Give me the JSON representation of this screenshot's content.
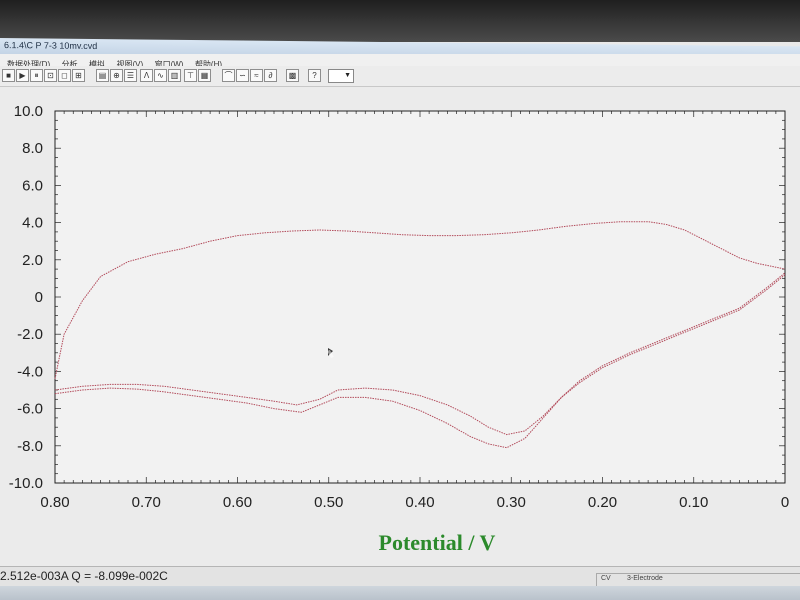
{
  "window": {
    "title": "6.1.4\\C P 7-3 10mv.cvd"
  },
  "menu": {
    "items": [
      "数据处理(D)",
      "分析",
      "模拟",
      "视图(V)",
      "窗口(W)",
      "帮助(H)"
    ]
  },
  "toolbar": {
    "combo_value": ""
  },
  "colors": {
    "curve": "#b24a5a",
    "axis": "#222222",
    "xlabel": "#2b8a2b"
  },
  "chart_data": {
    "type": "line",
    "title": "",
    "xlabel": "Potential / V",
    "ylabel": "",
    "xlim": [
      0.8,
      0.0
    ],
    "ylim": [
      -10.0,
      10.0
    ],
    "x_ticks": [
      0.8,
      0.7,
      0.6,
      0.5,
      0.4,
      0.3,
      0.2,
      0.1,
      0
    ],
    "x_tick_labels": [
      "0.80",
      "0.70",
      "0.60",
      "0.50",
      "0.40",
      "0.30",
      "0.20",
      "0.10",
      "0"
    ],
    "y_ticks": [
      10.0,
      8.0,
      6.0,
      4.0,
      2.0,
      0,
      -2.0,
      -4.0,
      -6.0,
      -8.0,
      -10.0
    ],
    "y_tick_labels": [
      "10.0",
      "8.0",
      "6.0",
      "4.0",
      "2.0",
      "0",
      "-2.0",
      "-4.0",
      "-6.0",
      "-8.0",
      "-10.0"
    ],
    "grid": false,
    "series": [
      {
        "x": [
          0.8,
          0.79,
          0.77,
          0.75,
          0.72,
          0.69,
          0.66,
          0.63,
          0.6,
          0.57,
          0.54,
          0.51,
          0.48,
          0.45,
          0.42,
          0.39,
          0.36,
          0.33,
          0.3,
          0.27,
          0.24,
          0.21,
          0.18,
          0.15,
          0.13,
          0.11,
          0.09,
          0.07,
          0.05,
          0.03,
          0.01,
          0.0
        ],
        "y": [
          -4.4,
          -2.0,
          -0.2,
          1.1,
          1.9,
          2.3,
          2.6,
          3.0,
          3.3,
          3.45,
          3.55,
          3.6,
          3.55,
          3.45,
          3.35,
          3.3,
          3.3,
          3.35,
          3.45,
          3.6,
          3.8,
          3.95,
          4.05,
          4.05,
          3.9,
          3.6,
          3.1,
          2.6,
          2.1,
          1.8,
          1.6,
          1.5
        ]
      },
      {
        "x": [
          0.8,
          0.77,
          0.74,
          0.71,
          0.68,
          0.65,
          0.62,
          0.59,
          0.56,
          0.535,
          0.51,
          0.49,
          0.46,
          0.43,
          0.4,
          0.37,
          0.345,
          0.325,
          0.305,
          0.285,
          0.265,
          0.245,
          0.225,
          0.2,
          0.17,
          0.14,
          0.11,
          0.08,
          0.05,
          0.02,
          0.0
        ],
        "y": [
          -5.0,
          -4.8,
          -4.7,
          -4.7,
          -4.8,
          -5.0,
          -5.2,
          -5.4,
          -5.6,
          -5.8,
          -5.5,
          -5.0,
          -4.9,
          -5.0,
          -5.3,
          -5.8,
          -6.4,
          -7.0,
          -7.4,
          -7.2,
          -6.4,
          -5.4,
          -4.5,
          -3.7,
          -3.0,
          -2.4,
          -1.8,
          -1.2,
          -0.6,
          0.5,
          1.3
        ]
      },
      {
        "x": [
          0.8,
          0.77,
          0.74,
          0.71,
          0.68,
          0.65,
          0.62,
          0.59,
          0.56,
          0.53,
          0.51,
          0.49,
          0.46,
          0.43,
          0.4,
          0.37,
          0.345,
          0.325,
          0.305,
          0.285,
          0.265,
          0.245,
          0.225,
          0.2,
          0.17,
          0.14,
          0.11,
          0.08,
          0.05,
          0.02,
          0.0
        ],
        "y": [
          -5.2,
          -5.0,
          -4.9,
          -4.95,
          -5.1,
          -5.3,
          -5.5,
          -5.7,
          -6.0,
          -6.2,
          -5.8,
          -5.4,
          -5.4,
          -5.6,
          -6.1,
          -6.8,
          -7.5,
          -7.9,
          -8.1,
          -7.6,
          -6.5,
          -5.4,
          -4.6,
          -3.8,
          -3.1,
          -2.5,
          -1.9,
          -1.3,
          -0.7,
          0.4,
          1.2
        ]
      }
    ]
  },
  "status": {
    "left": "2.512e-003A  Q = -8.099e-002C",
    "right_a": "CV",
    "right_b": "3-Electrode"
  }
}
